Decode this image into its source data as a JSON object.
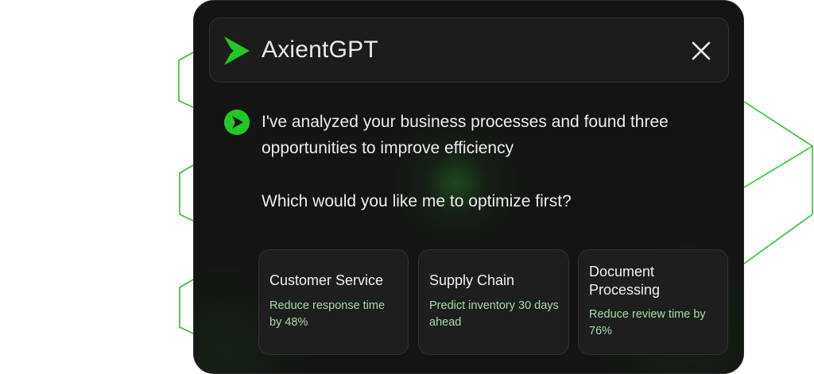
{
  "assistant": {
    "title": "AxientGPT",
    "logo_icon": "play-arrow-logo-icon",
    "close_icon": "close-icon",
    "accent_color": "#22c823"
  },
  "message": {
    "intro": "I've analyzed your business processes and found three opportunities to improve efficiency",
    "question": "Which would you like me to optimize first?"
  },
  "options": [
    {
      "title": "Customer Service",
      "description": "Reduce response time by 48%"
    },
    {
      "title": "Supply Chain",
      "description": "Predict inventory 30 days ahead"
    },
    {
      "title": "Document Processing",
      "description": "Reduce review time by 76%"
    }
  ]
}
